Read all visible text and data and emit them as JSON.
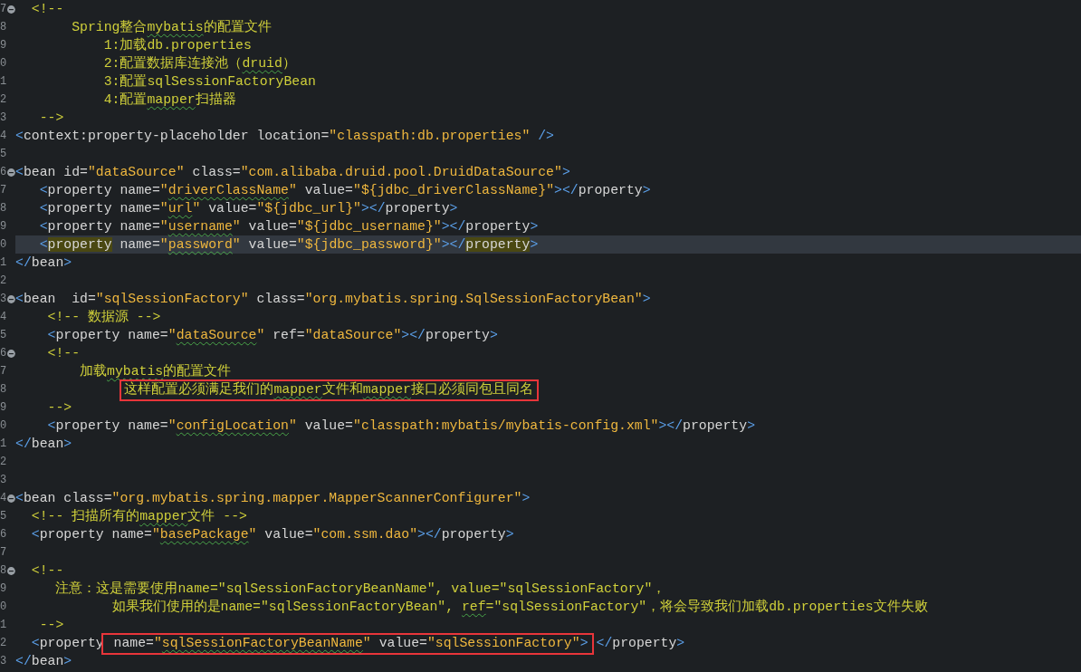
{
  "editor": {
    "lines": [
      {
        "number": "7",
        "fold": true,
        "current": false,
        "tokens": [
          {
            "kind": "comment",
            "text": "  <!--"
          }
        ]
      },
      {
        "number": "8",
        "fold": false,
        "current": false,
        "tokens": [
          {
            "kind": "comment",
            "text": "       Spring整合"
          },
          {
            "kind": "comment-misspelled",
            "text": "mybatis"
          },
          {
            "kind": "comment",
            "text": "的配置文件"
          }
        ]
      },
      {
        "number": "9",
        "fold": false,
        "current": false,
        "tokens": [
          {
            "kind": "comment",
            "text": "           1:加载db.properties"
          }
        ]
      },
      {
        "number": "0",
        "fold": false,
        "current": false,
        "tokens": [
          {
            "kind": "comment",
            "text": "           2:配置数据库连接池（"
          },
          {
            "kind": "comment-misspelled",
            "text": "druid"
          },
          {
            "kind": "comment",
            "text": "）"
          }
        ]
      },
      {
        "number": "1",
        "fold": false,
        "current": false,
        "tokens": [
          {
            "kind": "comment",
            "text": "           3:配置sqlSessionFactoryBean"
          }
        ]
      },
      {
        "number": "2",
        "fold": false,
        "current": false,
        "tokens": [
          {
            "kind": "comment",
            "text": "           4:配置"
          },
          {
            "kind": "comment-misspelled",
            "text": "mapper"
          },
          {
            "kind": "comment",
            "text": "扫描器"
          }
        ]
      },
      {
        "number": "3",
        "fold": false,
        "current": false,
        "tokens": [
          {
            "kind": "comment",
            "text": "   -->"
          }
        ]
      },
      {
        "number": "4",
        "fold": false,
        "current": false,
        "tokens": [
          {
            "kind": "punct",
            "text": "<"
          },
          {
            "kind": "tag",
            "text": "context:property-placeholder"
          },
          {
            "kind": "attr",
            "text": " location="
          },
          {
            "kind": "value",
            "text": "\"classpath:db.properties\""
          },
          {
            "kind": "punct",
            "text": " />"
          }
        ]
      },
      {
        "number": "5",
        "fold": false,
        "current": false
      },
      {
        "number": "6",
        "fold": true,
        "current": false,
        "tokens": [
          {
            "kind": "punct",
            "text": "<"
          },
          {
            "kind": "tag",
            "text": "bean"
          },
          {
            "kind": "attr",
            "text": " id="
          },
          {
            "kind": "value",
            "text": "\"dataSource\""
          },
          {
            "kind": "attr",
            "text": " class="
          },
          {
            "kind": "value",
            "text": "\"com.alibaba.druid.pool.DruidDataSource\""
          },
          {
            "kind": "punct",
            "text": ">"
          }
        ]
      },
      {
        "number": "7",
        "fold": false,
        "current": false,
        "tokens": [
          {
            "kind": "punct",
            "text": "   <"
          },
          {
            "kind": "tag",
            "text": "property"
          },
          {
            "kind": "attr",
            "text": " name="
          },
          {
            "kind": "value",
            "text": "\""
          },
          {
            "kind": "value-misspelled",
            "text": "driverClassName"
          },
          {
            "kind": "value",
            "text": "\""
          },
          {
            "kind": "attr",
            "text": " value="
          },
          {
            "kind": "value",
            "text": "\"${jdbc_driverClassName}\""
          },
          {
            "kind": "punct",
            "text": "></"
          },
          {
            "kind": "tag",
            "text": "property"
          },
          {
            "kind": "punct",
            "text": ">"
          }
        ]
      },
      {
        "number": "8",
        "fold": false,
        "current": false,
        "tokens": [
          {
            "kind": "punct",
            "text": "   <"
          },
          {
            "kind": "tag",
            "text": "property"
          },
          {
            "kind": "attr",
            "text": " name="
          },
          {
            "kind": "value",
            "text": "\""
          },
          {
            "kind": "value-misspelled",
            "text": "url"
          },
          {
            "kind": "value",
            "text": "\""
          },
          {
            "kind": "attr",
            "text": " value="
          },
          {
            "kind": "value",
            "text": "\"${jdbc_url}\""
          },
          {
            "kind": "punct",
            "text": "></"
          },
          {
            "kind": "tag",
            "text": "property"
          },
          {
            "kind": "punct",
            "text": ">"
          }
        ]
      },
      {
        "number": "9",
        "fold": false,
        "current": false,
        "tokens": [
          {
            "kind": "punct",
            "text": "   <"
          },
          {
            "kind": "tag",
            "text": "property"
          },
          {
            "kind": "attr",
            "text": " name="
          },
          {
            "kind": "value",
            "text": "\""
          },
          {
            "kind": "value-misspelled",
            "text": "username"
          },
          {
            "kind": "value",
            "text": "\""
          },
          {
            "kind": "attr",
            "text": " value="
          },
          {
            "kind": "value",
            "text": "\"${jdbc_username}\""
          },
          {
            "kind": "punct",
            "text": "></"
          },
          {
            "kind": "tag",
            "text": "property"
          },
          {
            "kind": "punct",
            "text": ">"
          }
        ]
      },
      {
        "number": "0",
        "fold": false,
        "current": true,
        "tokens": [
          {
            "kind": "punct",
            "text": "   <"
          },
          {
            "kind": "tag-matched",
            "text": "property"
          },
          {
            "kind": "attr",
            "text": " name="
          },
          {
            "kind": "value",
            "text": "\""
          },
          {
            "kind": "value-misspelled",
            "text": "password"
          },
          {
            "kind": "value",
            "text": "\""
          },
          {
            "kind": "attr",
            "text": " value="
          },
          {
            "kind": "value",
            "text": "\"${jdbc_password}\""
          },
          {
            "kind": "punct",
            "text": "></"
          },
          {
            "kind": "tag-matched",
            "text": "property"
          },
          {
            "kind": "punct",
            "text": ">"
          }
        ]
      },
      {
        "number": "1",
        "fold": false,
        "current": false,
        "tokens": [
          {
            "kind": "punct",
            "text": "</"
          },
          {
            "kind": "tag",
            "text": "bean"
          },
          {
            "kind": "punct",
            "text": ">"
          }
        ]
      },
      {
        "number": "2",
        "fold": false,
        "current": false
      },
      {
        "number": "3",
        "fold": true,
        "current": false,
        "tokens": [
          {
            "kind": "punct",
            "text": "<"
          },
          {
            "kind": "tag",
            "text": "bean"
          },
          {
            "kind": "attr",
            "text": "  id="
          },
          {
            "kind": "value",
            "text": "\"sqlSessionFactory\""
          },
          {
            "kind": "attr",
            "text": " class="
          },
          {
            "kind": "value",
            "text": "\"org.mybatis.spring.SqlSessionFactoryBean\""
          },
          {
            "kind": "punct",
            "text": ">"
          }
        ]
      },
      {
        "number": "4",
        "fold": false,
        "current": false,
        "tokens": [
          {
            "kind": "comment",
            "text": "    <!-- 数据源 -->"
          }
        ]
      },
      {
        "number": "5",
        "fold": false,
        "current": false,
        "tokens": [
          {
            "kind": "punct",
            "text": "    <"
          },
          {
            "kind": "tag",
            "text": "property"
          },
          {
            "kind": "attr",
            "text": " name="
          },
          {
            "kind": "value",
            "text": "\""
          },
          {
            "kind": "value-misspelled",
            "text": "dataSource"
          },
          {
            "kind": "value",
            "text": "\""
          },
          {
            "kind": "attr",
            "text": " ref="
          },
          {
            "kind": "value",
            "text": "\"dataSource\""
          },
          {
            "kind": "punct",
            "text": "></"
          },
          {
            "kind": "tag",
            "text": "property"
          },
          {
            "kind": "punct",
            "text": ">"
          }
        ]
      },
      {
        "number": "6",
        "fold": true,
        "current": false,
        "tokens": [
          {
            "kind": "comment",
            "text": "    <!--"
          }
        ]
      },
      {
        "number": "7",
        "fold": false,
        "current": false,
        "tokens": [
          {
            "kind": "comment",
            "text": "        加载"
          },
          {
            "kind": "comment-misspelled",
            "text": "mybatis"
          },
          {
            "kind": "comment",
            "text": "的配置文件"
          }
        ]
      },
      {
        "number": "8",
        "fold": false,
        "current": false,
        "tokens": [
          {
            "kind": "box",
            "tokens": [
              {
                "kind": "comment",
                "text": "这样配置必须满足我们的"
              },
              {
                "kind": "comment-misspelled",
                "text": "mapper"
              },
              {
                "kind": "comment",
                "text": "文件和"
              },
              {
                "kind": "comment-misspelled",
                "text": "mapper"
              },
              {
                "kind": "comment",
                "text": "接口必须同包且同名"
              }
            ]
          }
        ]
      },
      {
        "number": "9",
        "fold": false,
        "current": false,
        "tokens": [
          {
            "kind": "comment",
            "text": "    -->"
          }
        ]
      },
      {
        "number": "0",
        "fold": false,
        "current": false,
        "tokens": [
          {
            "kind": "punct",
            "text": "    <"
          },
          {
            "kind": "tag",
            "text": "property"
          },
          {
            "kind": "attr",
            "text": " name="
          },
          {
            "kind": "value",
            "text": "\""
          },
          {
            "kind": "value-misspelled",
            "text": "configLocation"
          },
          {
            "kind": "value",
            "text": "\""
          },
          {
            "kind": "attr",
            "text": " value="
          },
          {
            "kind": "value",
            "text": "\"classpath:mybatis/mybatis-config.xml\""
          },
          {
            "kind": "punct",
            "text": "></"
          },
          {
            "kind": "tag",
            "text": "property"
          },
          {
            "kind": "punct",
            "text": ">"
          }
        ]
      },
      {
        "number": "1",
        "fold": false,
        "current": false,
        "tokens": [
          {
            "kind": "punct",
            "text": "</"
          },
          {
            "kind": "tag",
            "text": "bean"
          },
          {
            "kind": "punct",
            "text": ">"
          }
        ]
      },
      {
        "number": "2",
        "fold": false,
        "current": false
      },
      {
        "number": "3",
        "fold": false,
        "current": false
      },
      {
        "number": "4",
        "fold": true,
        "current": false,
        "tokens": [
          {
            "kind": "punct",
            "text": "<"
          },
          {
            "kind": "tag",
            "text": "bean"
          },
          {
            "kind": "attr",
            "text": " class="
          },
          {
            "kind": "value",
            "text": "\"org.mybatis.spring.mapper.MapperScannerConfigurer\""
          },
          {
            "kind": "punct",
            "text": ">"
          }
        ]
      },
      {
        "number": "5",
        "fold": false,
        "current": false,
        "tokens": [
          {
            "kind": "comment",
            "text": "  <!-- 扫描所有的"
          },
          {
            "kind": "comment-misspelled",
            "text": "mapper"
          },
          {
            "kind": "comment",
            "text": "文件 -->"
          }
        ]
      },
      {
        "number": "6",
        "fold": false,
        "current": false,
        "tokens": [
          {
            "kind": "punct",
            "text": "  <"
          },
          {
            "kind": "tag",
            "text": "property"
          },
          {
            "kind": "attr",
            "text": " name="
          },
          {
            "kind": "value",
            "text": "\""
          },
          {
            "kind": "value-misspelled",
            "text": "basePackage"
          },
          {
            "kind": "value",
            "text": "\""
          },
          {
            "kind": "attr",
            "text": " value="
          },
          {
            "kind": "value",
            "text": "\"com.ssm.dao\""
          },
          {
            "kind": "punct",
            "text": "></"
          },
          {
            "kind": "tag",
            "text": "property"
          },
          {
            "kind": "punct",
            "text": ">"
          }
        ]
      },
      {
        "number": "7",
        "fold": false,
        "current": false
      },
      {
        "number": "8",
        "fold": true,
        "current": false,
        "tokens": [
          {
            "kind": "comment",
            "text": "  <!--"
          }
        ]
      },
      {
        "number": "9",
        "fold": false,
        "current": false,
        "tokens": [
          {
            "kind": "comment",
            "text": "     注意：这是需要使用name=\"sqlSessionFactoryBeanName\", value=\"sqlSessionFactory\"，"
          }
        ]
      },
      {
        "number": "0",
        "fold": false,
        "current": false,
        "tokens": [
          {
            "kind": "comment",
            "text": "            如果我们使用的是name=\"sqlSessionFactoryBean\", "
          },
          {
            "kind": "comment-misspelled",
            "text": "ref"
          },
          {
            "kind": "comment",
            "text": "=\"sqlSessionFactory\"，将会导致我们加载db.properties文件失败"
          }
        ]
      },
      {
        "number": "1",
        "fold": false,
        "current": false,
        "tokens": [
          {
            "kind": "comment",
            "text": "   -->"
          }
        ]
      },
      {
        "number": "2",
        "fold": false,
        "current": false,
        "tokens": [
          {
            "kind": "punct",
            "text": "  <"
          },
          {
            "kind": "tag",
            "text": "property"
          },
          {
            "kind": "box",
            "tokens": [
              {
                "kind": "attr",
                "text": " name="
              },
              {
                "kind": "value",
                "text": "\""
              },
              {
                "kind": "value-misspelled",
                "text": "sqlSessionFactoryBeanName"
              },
              {
                "kind": "value",
                "text": "\""
              },
              {
                "kind": "attr",
                "text": " value="
              },
              {
                "kind": "value",
                "text": "\"sqlSessionFactory\""
              },
              {
                "kind": "punct",
                "text": ">"
              }
            ]
          },
          {
            "kind": "punct",
            "text": "</"
          },
          {
            "kind": "tag",
            "text": "property"
          },
          {
            "kind": "punct",
            "text": ">"
          }
        ]
      },
      {
        "number": "3",
        "fold": false,
        "current": false,
        "tokens": [
          {
            "kind": "punct",
            "text": "</"
          },
          {
            "kind": "tag",
            "text": "bean"
          },
          {
            "kind": "punct",
            "text": ">"
          }
        ]
      }
    ]
  }
}
